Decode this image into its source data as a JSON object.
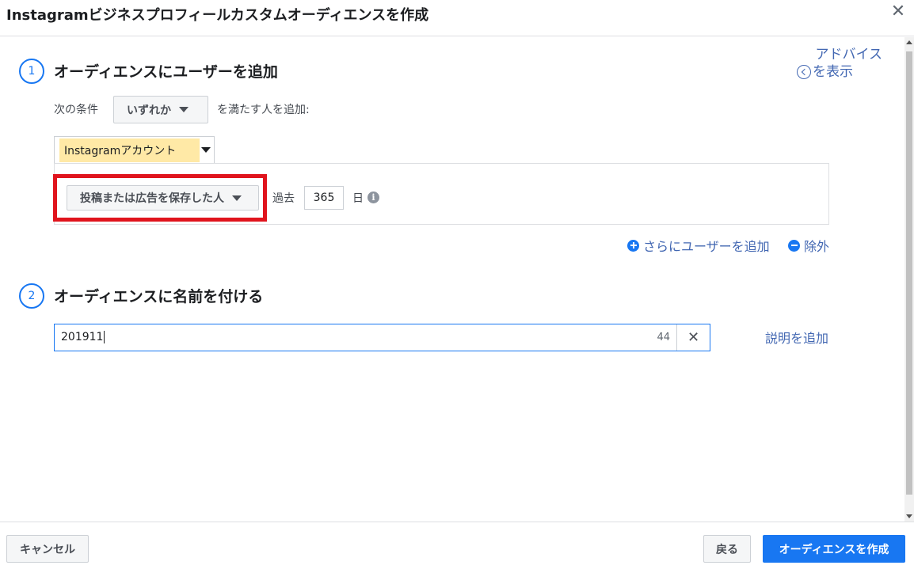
{
  "dialog": {
    "title": "Instagramビジネスプロフィールカスタムオーディエンスを作成",
    "close_symbol": "✕"
  },
  "advice": {
    "line1": "アドバイス",
    "line2": "を表示"
  },
  "step1": {
    "number": "1",
    "title": "オーディエンスにユーザーを追加",
    "condition_prefix": "次の条件",
    "condition_value": "いずれか",
    "condition_suffix": "を満たす人を追加:",
    "source_value": "Instagramアカウント",
    "rule_value": "投稿または広告を保存した人",
    "past_label": "過去",
    "days_value": "365",
    "days_unit": "日",
    "info_symbol": "i",
    "add_users_link": "さらにユーザーを追加",
    "exclude_link": "除外"
  },
  "step2": {
    "number": "2",
    "title": "オーディエンスに名前を付ける",
    "name_value": "201911",
    "char_count": "44",
    "clear_symbol": "✕",
    "add_description_link": "説明を追加"
  },
  "footer": {
    "cancel_label": "キャンセル",
    "back_label": "戻る",
    "create_label": "オーディエンスを作成"
  },
  "colors": {
    "accent": "#1877f2",
    "link": "#4267b2",
    "highlight_frame": "#e0141d",
    "source_highlight": "#ffe9a6"
  }
}
